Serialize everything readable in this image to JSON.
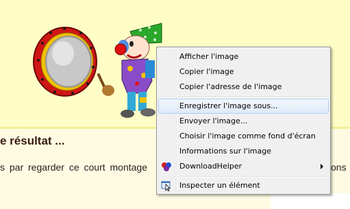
{
  "page": {
    "heading": "e résultat ...",
    "body_left": "s par regarder ce court montage",
    "body_right": "ons"
  },
  "context_menu": {
    "items": [
      {
        "label": "Afficher l'image"
      },
      {
        "label": "Copier l'image"
      },
      {
        "label": "Copier l'adresse de l'image"
      },
      {
        "label": "Enregistrer l'image sous...",
        "highlighted": true
      },
      {
        "label": "Envoyer l'image..."
      },
      {
        "label": "Choisir l'image comme fond d'écran"
      },
      {
        "label": "Informations sur l'image"
      },
      {
        "label": "DownloadHelper",
        "icon": "downloadhelper-icon",
        "has_submenu": true
      },
      {
        "label": "Inspecter un élément",
        "icon": "inspect-element-icon"
      }
    ]
  },
  "colors": {
    "page_background": "#fffdc6",
    "menu_background": "#f0f0f0",
    "highlight_border": "#aecff7"
  }
}
